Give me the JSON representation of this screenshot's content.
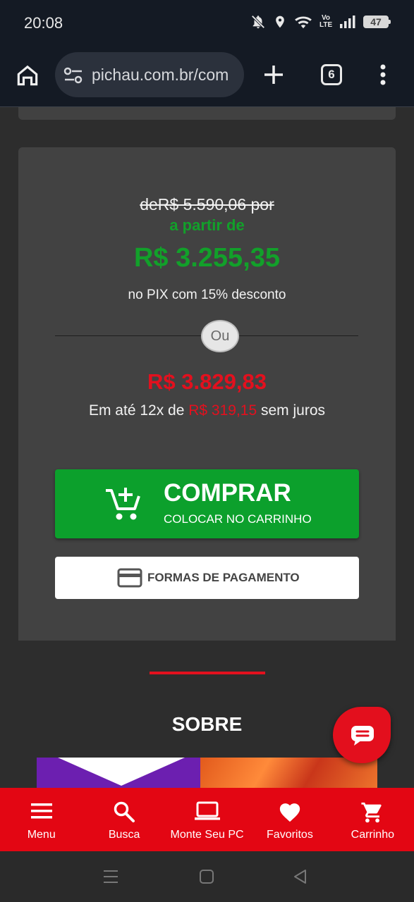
{
  "status_bar": {
    "time": "20:08",
    "network_label_top": "Vo",
    "network_label_bottom": "LTE",
    "battery": "47",
    "icons": [
      "mute-icon",
      "location-icon",
      "wifi-icon",
      "signal-icon",
      "battery-icon"
    ]
  },
  "browser": {
    "url": "pichau.com.br/com",
    "tab_count": "6",
    "icons": [
      "home-icon",
      "tune-icon",
      "plus-icon",
      "more-vert-icon"
    ]
  },
  "price_card": {
    "old_price": "deR$ 5.590,06 por",
    "from_label": "a partir de",
    "pix_price": "R$ 3.255,35",
    "pix_note": "no PIX com 15% desconto",
    "or_label": "Ou",
    "card_price": "R$ 3.829,83",
    "installments_prefix": "Em até 12x de",
    "installment_value": "R$ 319,15",
    "installments_suffix": "sem juros",
    "buy_title": "COMPRAR",
    "buy_subtitle": "COLOCAR NO CARRINHO",
    "payment_label": "FORMAS DE PAGAMENTO"
  },
  "sobre": {
    "title": "SOBRE"
  },
  "bottom_nav": {
    "items": [
      {
        "label": "Menu",
        "icon": "menu-icon"
      },
      {
        "label": "Busca",
        "icon": "search-icon"
      },
      {
        "label": "Monte Seu PC",
        "icon": "laptop-icon"
      },
      {
        "label": "Favoritos",
        "icon": "heart-icon"
      },
      {
        "label": "Carrinho",
        "icon": "cart-icon"
      }
    ]
  },
  "colors": {
    "green": "#12a02a",
    "red": "#e3101e",
    "nav_red": "#e30613",
    "button_green": "#0ca02c",
    "card_bg": "#424242"
  }
}
